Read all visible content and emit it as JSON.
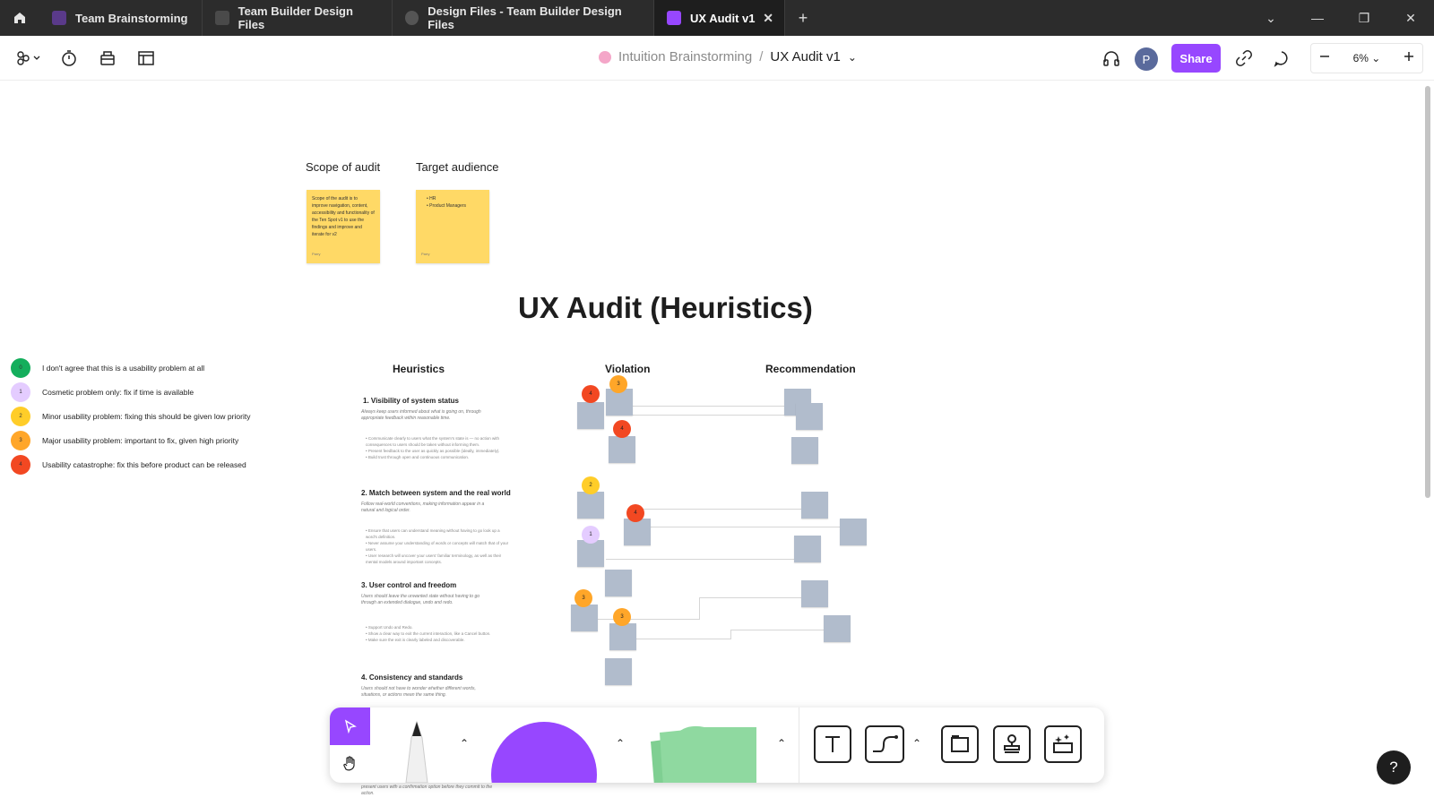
{
  "tabs": [
    {
      "label": "Team Brainstorming",
      "icon": "figjam-icon",
      "color": "#7b3fbf"
    },
    {
      "label": "Team Builder Design Files",
      "icon": "file-icon",
      "color": "#555555"
    },
    {
      "label": "Design Files - Team Builder Design Files",
      "icon": "play-icon",
      "color": "#555555"
    },
    {
      "label": "UX Audit v1",
      "icon": "figjam-icon",
      "color": "#9747ff",
      "active": true
    }
  ],
  "breadcrumb": {
    "parent": "Intuition Brainstorming",
    "separator": "/",
    "current": "UX Audit v1"
  },
  "toolbar": {
    "share_label": "Share",
    "avatar_initial": "P",
    "zoom_level": "6%"
  },
  "canvas": {
    "scope": {
      "heading": "Scope of audit",
      "sticky_text": "Scope of the audit is to improve navigation, content, accessibility and functionality of the Ten Spot v1 to use the findings and improve and iterate for v2",
      "author": "Parry"
    },
    "audience": {
      "heading": "Target audience",
      "items": [
        "HR",
        "Product Managers",
        ""
      ],
      "author": "Parry"
    },
    "title": "UX Audit (Heuristics)",
    "legend": [
      {
        "value": "0",
        "text": "I don't agree that this is a usability problem at all",
        "color": "#14ae5c"
      },
      {
        "value": "1",
        "text": "Cosmetic problem only: fix if time is available",
        "color": "#e4ccff"
      },
      {
        "value": "2",
        "text": "Minor usability problem: fixing this should be given low priority",
        "color": "#ffcd29"
      },
      {
        "value": "3",
        "text": "Major usability problem: important to fix, given high priority",
        "color": "#ffa629"
      },
      {
        "value": "4",
        "text": "Usability catastrophe: fix this before product can be released",
        "color": "#f24822"
      }
    ],
    "columns": {
      "heuristics": "Heuristics",
      "violation": "Violation",
      "recommendation": "Recommendation"
    },
    "heuristics": [
      {
        "title": "1. Visibility of system status",
        "desc": "Always keep users informed about what is going on, through appropriate feedback within reasonable time.",
        "bullets": [
          "Communicate clearly to users what the system's state is — no action with consequences to users should be taken without informing them.",
          "Present feedback to the user as quickly as possible (ideally, immediately).",
          "Build trust through open and continuous communication."
        ]
      },
      {
        "title": "2. Match between system and the real world",
        "desc": "Follow real-world conventions, making information appear in a natural and logical order.",
        "bullets": [
          "Ensure that users can understand meaning without having to go look up a word's definition.",
          "Never assume your understanding of words or concepts will match that of your users.",
          "User research will uncover your users' familiar terminology, as well as their mental models around important concepts."
        ]
      },
      {
        "title": "3. User control and freedom",
        "desc": "Users should leave the unwanted state without having to go through an extended dialogue, undo and redo.",
        "bullets": [
          "Support Undo and Redo.",
          "Show a clear way to exit the current interaction, like a Cancel button.",
          "Make sure the exit is clearly labeled and discoverable."
        ]
      },
      {
        "title": "4. Consistency and standards",
        "desc": "Users should not have to wonder whether different words, situations, or actions mean the same thing.",
        "bullets": []
      }
    ],
    "footer_note": "Either eliminate error-prone conditions or check for them and present users with a confirmation option before they commit to the action."
  },
  "badges": [
    "4",
    "3",
    "4",
    "2",
    "4",
    "1",
    "3",
    "3"
  ],
  "colors": {
    "accent": "#9747ff",
    "tabbar": "#2c2c2c",
    "sticky_yellow": "#ffd966",
    "sticky_gray": "#b1bccc",
    "shape_purple": "#9747ff",
    "sticky_green": "#8fd9a0"
  },
  "icons": [
    "home-icon",
    "figma-menu-icon",
    "timer-icon",
    "library-icon",
    "layout-icon",
    "headphones-icon",
    "link-icon",
    "comment-icon",
    "minus-icon",
    "plus-icon",
    "cursor-icon",
    "hand-icon",
    "marker-icon",
    "text-icon",
    "connector-icon",
    "section-icon",
    "stamp-icon",
    "ai-icon",
    "help-icon"
  ],
  "help_label": "?"
}
